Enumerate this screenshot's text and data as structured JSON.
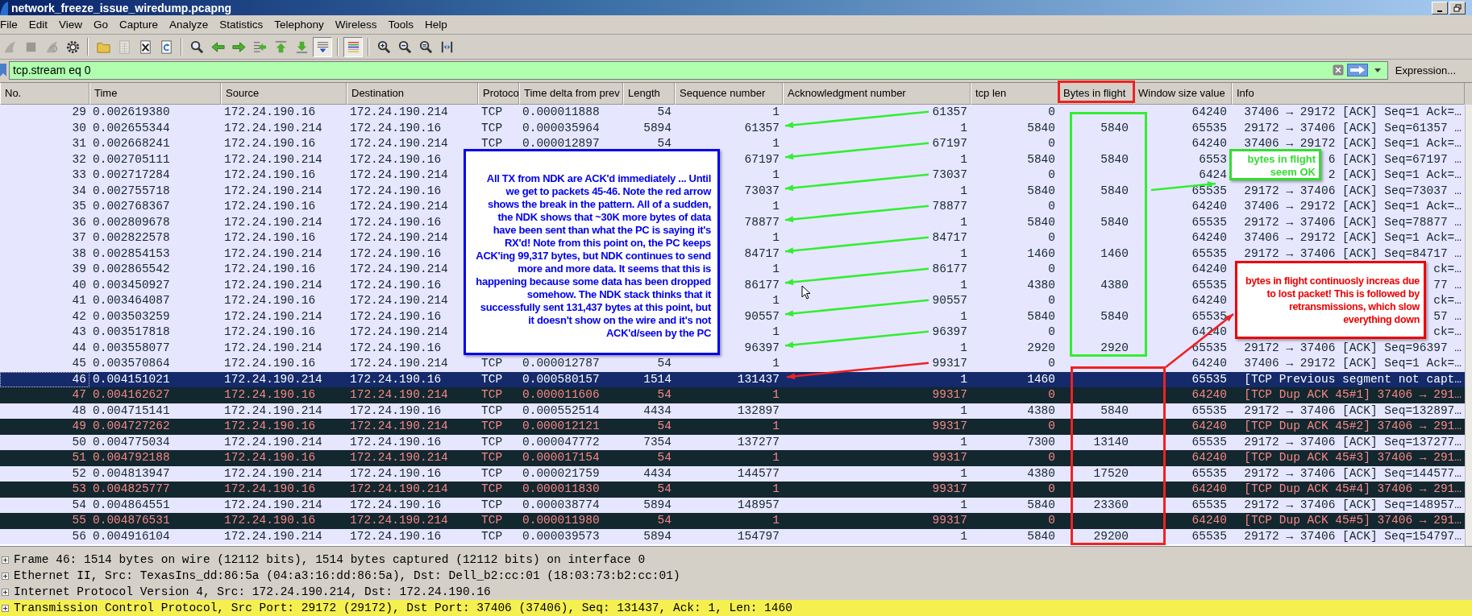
{
  "window": {
    "title": "network_freeze_issue_wiredump.pcapng"
  },
  "menu": [
    "File",
    "Edit",
    "View",
    "Go",
    "Capture",
    "Analyze",
    "Statistics",
    "Telephony",
    "Wireless",
    "Tools",
    "Help"
  ],
  "toolbar": [
    {
      "tools": [
        {
          "kind": "start",
          "disabled": true,
          "on": false
        },
        {
          "kind": "stop",
          "disabled": true,
          "on": false
        },
        {
          "kind": "restart",
          "disabled": true,
          "on": false
        },
        {
          "kind": "options",
          "disabled": false,
          "on": false
        }
      ]
    },
    {
      "tools": [
        {
          "kind": "open",
          "disabled": false,
          "on": false
        },
        {
          "kind": "file",
          "disabled": true,
          "on": false
        },
        {
          "kind": "close",
          "disabled": false,
          "on": false
        },
        {
          "kind": "reload",
          "disabled": false,
          "on": false
        }
      ]
    },
    {
      "tools": [
        {
          "kind": "find",
          "disabled": false,
          "on": false
        },
        {
          "kind": "back",
          "disabled": false,
          "on": false
        },
        {
          "kind": "forward",
          "disabled": false,
          "on": false
        },
        {
          "kind": "goto",
          "disabled": false,
          "on": false
        },
        {
          "kind": "first",
          "disabled": false,
          "on": false
        },
        {
          "kind": "last",
          "disabled": false,
          "on": false
        },
        {
          "kind": "autoscroll",
          "disabled": false,
          "on": true
        }
      ]
    },
    {
      "tools": [
        {
          "kind": "colorize",
          "disabled": false,
          "on": true
        }
      ]
    },
    {
      "tools": [
        {
          "kind": "zoom-in",
          "disabled": false,
          "on": false
        },
        {
          "kind": "zoom-out",
          "disabled": false,
          "on": false
        },
        {
          "kind": "zoom-reset",
          "disabled": false,
          "on": false
        },
        {
          "kind": "resize",
          "disabled": false,
          "on": false
        }
      ]
    }
  ],
  "filter": {
    "value": "tcp.stream eq 0",
    "expression_button": "Expression..."
  },
  "packet_list": {
    "columns": [
      "No.",
      "Time",
      "Source",
      "Destination",
      "Protoco",
      "Time delta from prev",
      "Length",
      "Sequence number",
      "Acknowledgment number",
      "tcp len",
      "Bytes in flight",
      "Window size value",
      "Info"
    ],
    "rows": [
      {
        "no": "29",
        "time": "0.002619380",
        "source": "172.24.190.16",
        "destination": "172.24.190.214",
        "protocol": "TCP",
        "delta": "0.000011888",
        "length": "54",
        "seq": "1",
        "ack": "61357",
        "tcp_len": "0",
        "window": "64240",
        "info": "37406 → 29172 [ACK] Seq=1 Ack=…",
        "kind": "normal",
        "selected": false
      },
      {
        "no": "30",
        "time": "0.002655344",
        "source": "172.24.190.214",
        "destination": "172.24.190.16",
        "protocol": "TCP",
        "delta": "0.000035964",
        "length": "5894",
        "seq": "61357",
        "ack": "1",
        "tcp_len": "5840",
        "bytes_in_flight": "5840",
        "window": "65535",
        "info": "29172 → 37406 [ACK] Seq=61357 …",
        "kind": "normal",
        "selected": false
      },
      {
        "no": "31",
        "time": "0.002668241",
        "source": "172.24.190.16",
        "destination": "172.24.190.214",
        "protocol": "TCP",
        "delta": "0.000012897",
        "length": "54",
        "seq": "1",
        "ack": "67197",
        "tcp_len": "0",
        "window": "64240",
        "info": "37406 → 29172 [ACK] Seq=1 Ack=…",
        "kind": "normal",
        "selected": false
      },
      {
        "no": "32",
        "time": "0.002705111",
        "source": "172.24.190.214",
        "destination": "172.24.190.16",
        "seq": "67197",
        "ack": "1",
        "tcp_len": "5840",
        "bytes_in_flight": "5840",
        "window": "6553",
        "info": "6 [ACK] Seq=67197 …",
        "kind": "normal",
        "selected": false
      },
      {
        "no": "33",
        "time": "0.002717284",
        "source": "172.24.190.16",
        "destination": "172.24.190.214",
        "seq": "1",
        "ack": "73037",
        "tcp_len": "0",
        "window": "6424",
        "info": "2 [ACK] Seq=1 Ack=…",
        "kind": "normal",
        "selected": false
      },
      {
        "no": "34",
        "time": "0.002755718",
        "source": "172.24.190.214",
        "destination": "172.24.190.16",
        "seq": "73037",
        "ack": "1",
        "tcp_len": "5840",
        "bytes_in_flight": "5840",
        "window": "65535",
        "info": "29172 → 37406 [ACK] Seq=73037 …",
        "kind": "normal",
        "selected": false
      },
      {
        "no": "35",
        "time": "0.002768367",
        "source": "172.24.190.16",
        "destination": "172.24.190.214",
        "seq": "1",
        "ack": "78877",
        "tcp_len": "0",
        "window": "64240",
        "info": "37406 → 29172 [ACK] Seq=1 Ack=…",
        "kind": "normal",
        "selected": false
      },
      {
        "no": "36",
        "time": "0.002809678",
        "source": "172.24.190.214",
        "destination": "172.24.190.16",
        "seq": "78877",
        "ack": "1",
        "tcp_len": "5840",
        "bytes_in_flight": "5840",
        "window": "65535",
        "info": "29172 → 37406 [ACK] Seq=78877 …",
        "kind": "normal",
        "selected": false
      },
      {
        "no": "37",
        "time": "0.002822578",
        "source": "172.24.190.16",
        "destination": "172.24.190.214",
        "seq": "1",
        "ack": "84717",
        "tcp_len": "0",
        "window": "64240",
        "info": "37406 → 29172 [ACK] Seq=1 Ack=…",
        "kind": "normal",
        "selected": false
      },
      {
        "no": "38",
        "time": "0.002854153",
        "source": "172.24.190.214",
        "destination": "172.24.190.16",
        "seq": "84717",
        "ack": "1",
        "tcp_len": "1460",
        "bytes_in_flight": "1460",
        "window": "65535",
        "info": "29172 → 37406 [ACK] Seq=84717 …",
        "kind": "normal",
        "selected": false
      },
      {
        "no": "39",
        "time": "0.002865542",
        "source": "172.24.190.16",
        "destination": "172.24.190.214",
        "seq": "1",
        "ack": "86177",
        "tcp_len": "0",
        "window": "64240",
        "info": "ck=…",
        "kind": "normal",
        "selected": false
      },
      {
        "no": "40",
        "time": "0.003450927",
        "source": "172.24.190.214",
        "destination": "172.24.190.16",
        "seq": "86177",
        "ack": "1",
        "tcp_len": "4380",
        "bytes_in_flight": "4380",
        "window": "65535",
        "info": "77 …",
        "kind": "normal",
        "selected": false
      },
      {
        "no": "41",
        "time": "0.003464087",
        "source": "172.24.190.16",
        "destination": "172.24.190.214",
        "seq": "1",
        "ack": "90557",
        "tcp_len": "0",
        "window": "64240",
        "info": "ck=…",
        "kind": "normal",
        "selected": false
      },
      {
        "no": "42",
        "time": "0.003503259",
        "source": "172.24.190.214",
        "destination": "172.24.190.16",
        "seq": "90557",
        "ack": "1",
        "tcp_len": "5840",
        "bytes_in_flight": "5840",
        "window": "65535",
        "info": "57 …",
        "kind": "normal",
        "selected": false
      },
      {
        "no": "43",
        "time": "0.003517818",
        "source": "172.24.190.16",
        "destination": "172.24.190.214",
        "seq": "1",
        "ack": "96397",
        "tcp_len": "0",
        "window": "64240",
        "info": "ck=…",
        "kind": "normal",
        "selected": false
      },
      {
        "no": "44",
        "time": "0.003558077",
        "source": "172.24.190.214",
        "destination": "172.24.190.16",
        "seq": "96397",
        "ack": "1",
        "tcp_len": "2920",
        "bytes_in_flight": "2920",
        "window": "65535",
        "info": "29172 → 37406 [ACK] Seq=96397 …",
        "kind": "normal",
        "selected": false
      },
      {
        "no": "45",
        "time": "0.003570864",
        "source": "172.24.190.16",
        "destination": "172.24.190.214",
        "protocol": "TCP",
        "delta": "0.000012787",
        "length": "54",
        "seq": "1",
        "ack": "99317",
        "tcp_len": "0",
        "window": "64240",
        "info": "37406 → 29172 [ACK] Seq=1 Ack=…",
        "kind": "normal",
        "selected": false
      },
      {
        "no": "46",
        "time": "0.004151021",
        "source": "172.24.190.214",
        "destination": "172.24.190.16",
        "protocol": "TCP",
        "delta": "0.000580157",
        "length": "1514",
        "seq": "131437",
        "ack": "1",
        "tcp_len": "1460",
        "window": "65535",
        "info": "[TCP Previous segment not capt…",
        "kind": "normal",
        "selected": true
      },
      {
        "no": "47",
        "time": "0.004162627",
        "source": "172.24.190.16",
        "destination": "172.24.190.214",
        "protocol": "TCP",
        "delta": "0.000011606",
        "length": "54",
        "seq": "1",
        "ack": "99317",
        "tcp_len": "0",
        "window": "64240",
        "info": "[TCP Dup ACK 45#1] 37406 → 291…",
        "kind": "dup_ack",
        "selected": false
      },
      {
        "no": "48",
        "time": "0.004715141",
        "source": "172.24.190.214",
        "destination": "172.24.190.16",
        "protocol": "TCP",
        "delta": "0.000552514",
        "length": "4434",
        "seq": "132897",
        "ack": "1",
        "tcp_len": "4380",
        "bytes_in_flight": "5840",
        "window": "65535",
        "info": "29172 → 37406 [ACK] Seq=132897…",
        "kind": "normal",
        "selected": false
      },
      {
        "no": "49",
        "time": "0.004727262",
        "source": "172.24.190.16",
        "destination": "172.24.190.214",
        "protocol": "TCP",
        "delta": "0.000012121",
        "length": "54",
        "seq": "1",
        "ack": "99317",
        "tcp_len": "0",
        "window": "64240",
        "info": "[TCP Dup ACK 45#2] 37406 → 291…",
        "kind": "dup_ack",
        "selected": false
      },
      {
        "no": "50",
        "time": "0.004775034",
        "source": "172.24.190.214",
        "destination": "172.24.190.16",
        "protocol": "TCP",
        "delta": "0.000047772",
        "length": "7354",
        "seq": "137277",
        "ack": "1",
        "tcp_len": "7300",
        "bytes_in_flight": "13140",
        "window": "65535",
        "info": "29172 → 37406 [ACK] Seq=137277…",
        "kind": "normal",
        "selected": false
      },
      {
        "no": "51",
        "time": "0.004792188",
        "source": "172.24.190.16",
        "destination": "172.24.190.214",
        "protocol": "TCP",
        "delta": "0.000017154",
        "length": "54",
        "seq": "1",
        "ack": "99317",
        "tcp_len": "0",
        "window": "64240",
        "info": "[TCP Dup ACK 45#3] 37406 → 291…",
        "kind": "dup_ack",
        "selected": false
      },
      {
        "no": "52",
        "time": "0.004813947",
        "source": "172.24.190.214",
        "destination": "172.24.190.16",
        "protocol": "TCP",
        "delta": "0.000021759",
        "length": "4434",
        "seq": "144577",
        "ack": "1",
        "tcp_len": "4380",
        "bytes_in_flight": "17520",
        "window": "65535",
        "info": "29172 → 37406 [ACK] Seq=144577…",
        "kind": "normal",
        "selected": false
      },
      {
        "no": "53",
        "time": "0.004825777",
        "source": "172.24.190.16",
        "destination": "172.24.190.214",
        "protocol": "TCP",
        "delta": "0.000011830",
        "length": "54",
        "seq": "1",
        "ack": "99317",
        "tcp_len": "0",
        "window": "64240",
        "info": "[TCP Dup ACK 45#4] 37406 → 291…",
        "kind": "dup_ack",
        "selected": false
      },
      {
        "no": "54",
        "time": "0.004864551",
        "source": "172.24.190.214",
        "destination": "172.24.190.16",
        "protocol": "TCP",
        "delta": "0.000038774",
        "length": "5894",
        "seq": "148957",
        "ack": "1",
        "tcp_len": "5840",
        "bytes_in_flight": "23360",
        "window": "65535",
        "info": "29172 → 37406 [ACK] Seq=148957…",
        "kind": "normal",
        "selected": false
      },
      {
        "no": "55",
        "time": "0.004876531",
        "source": "172.24.190.16",
        "destination": "172.24.190.214",
        "protocol": "TCP",
        "delta": "0.000011980",
        "length": "54",
        "seq": "1",
        "ack": "99317",
        "tcp_len": "0",
        "window": "64240",
        "info": "[TCP Dup ACK 45#5] 37406 → 291…",
        "kind": "dup_ack",
        "selected": false
      },
      {
        "no": "56",
        "time": "0.004916104",
        "source": "172.24.190.214",
        "destination": "172.24.190.16",
        "protocol": "TCP",
        "delta": "0.000039573",
        "length": "5894",
        "seq": "154797",
        "ack": "1",
        "tcp_len": "5840",
        "bytes_in_flight": "29200",
        "window": "65535",
        "info": "29172 → 37406 [ACK] Seq=154797…",
        "kind": "normal",
        "selected": false
      }
    ]
  },
  "notes": [
    {
      "kind": "explanation",
      "color": "#0000ee",
      "text": "All TX from NDK are ACK'd immediately ... Until we get to packets 45-46.  Note the red arrow shows the break in the pattern. All of a sudden, the NDK shows that ~30K more bytes of data have been sent than what the PC is saying it's RX'd! Note from this point on, the PC keeps ACK'ing 99,317 bytes, but NDK continues to send more and more data. It seems that this is happening because some data has been dropped somehow.  The NDK stack thinks that it successfully sent 131,437 bytes at this point, but it doesn't show on the wire and it's not ACK'd/seen by the PC"
    },
    {
      "kind": "ok",
      "color": "#33dd33",
      "text": "bytes in flight seem OK"
    },
    {
      "kind": "problem",
      "color": "#ee0000",
      "text": "bytes in flight continuosly increas due to lost packet! This is followed by retransmissions, which slow everything down"
    }
  ],
  "details": [
    {
      "text": "Frame 46: 1514 bytes on wire (12112 bits), 1514 bytes captured (12112 bits) on interface 0",
      "selected": false
    },
    {
      "text": "Ethernet II, Src: TexasIns_dd:86:5a (04:a3:16:dd:86:5a), Dst: Dell_b2:cc:01 (18:03:73:b2:cc:01)",
      "selected": false
    },
    {
      "text": "Internet Protocol Version 4, Src: 172.24.190.214, Dst: 172.24.190.16",
      "selected": false
    },
    {
      "text": "Transmission Control Protocol, Src Port: 29172 (29172), Dst Port: 37406 (37406), Seq: 131437, Ack: 1, Len: 1460",
      "selected": true
    }
  ]
}
